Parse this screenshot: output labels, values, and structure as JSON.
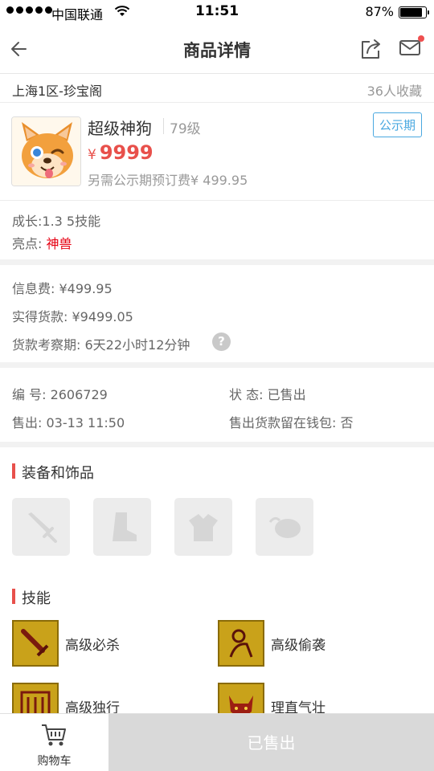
{
  "status_bar": {
    "carrier": "中国联通",
    "time": "11:51",
    "battery": "87%",
    "battery_level": 0.87
  },
  "nav": {
    "title": "商品详情",
    "back_icon": "back-arrow-icon",
    "share_icon": "share-icon",
    "mail_icon": "mail-icon",
    "mail_dot_color": "#ee4f4f"
  },
  "server": {
    "name": "上海1区-珍宝阁",
    "favorites": "36人收藏"
  },
  "item": {
    "name": "超级神狗",
    "level": "79级",
    "price_symbol": "¥",
    "price": "9999",
    "extra_fee": "另需公示期预订费¥ 499.95",
    "badge": "公示期",
    "price_color": "#e8504b",
    "badge_color": "#4aa8e0"
  },
  "attributes": {
    "growth": "成长:1.3 5技能",
    "highlight_label": "亮点: ",
    "highlight_value": "神兽",
    "highlight_color": "#e60012"
  },
  "fees": {
    "info_fee": "信息费: ¥499.95",
    "actual_payment": "实得货款: ¥9499.05",
    "review_period": "货款考察期: 6天22小时12分钟",
    "help": "?"
  },
  "meta": {
    "serial": "编   号: 2606729",
    "status": "状   态: 已售出",
    "sold_at": "售出: 03-13 11:50",
    "wallet": "售出货款留在钱包: 否"
  },
  "equipment": {
    "title": "装备和饰品",
    "slots": [
      "sword-icon",
      "boot-icon",
      "armor-icon",
      "ornament-icon"
    ]
  },
  "skills": {
    "title": "技能",
    "items": [
      {
        "label": "高级必杀",
        "icon": "sword-skill-icon"
      },
      {
        "label": "高级偷袭",
        "icon": "sneak-skill-icon"
      },
      {
        "label": "高级独行",
        "icon": "solo-skill-icon"
      },
      {
        "label": "理直气壮",
        "icon": "beast-skill-icon"
      }
    ]
  },
  "bottom": {
    "cart_label": "购物车",
    "sold_label": "已售出"
  }
}
